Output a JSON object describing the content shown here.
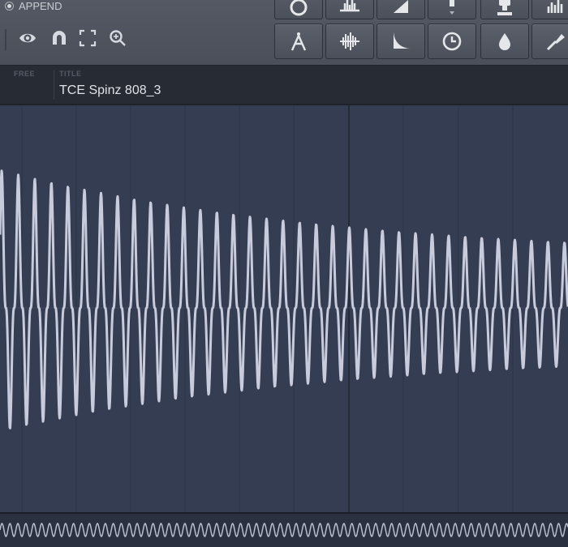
{
  "toolbar": {
    "append_label": "APPEND",
    "left_tools": [
      {
        "name": "eye-icon"
      },
      {
        "name": "magnet-icon"
      },
      {
        "name": "fit-view-icon"
      },
      {
        "name": "zoom-icon"
      }
    ],
    "buttons_row1": [
      {
        "name": "loop-icon"
      },
      {
        "name": "waveform-spike-icon"
      },
      {
        "name": "fade-icon"
      },
      {
        "name": "normalize-icon"
      },
      {
        "name": "stamp-icon"
      },
      {
        "name": "levels-icon"
      }
    ],
    "buttons_row2": [
      {
        "name": "compass-icon"
      },
      {
        "name": "spectrum-icon"
      },
      {
        "name": "decay-curve-icon"
      },
      {
        "name": "clock-icon"
      },
      {
        "name": "drop-icon"
      },
      {
        "name": "brush-icon"
      }
    ]
  },
  "info": {
    "free_label": "FREE",
    "title_label": "TITLE",
    "title_value": "TCE Spinz 808_3"
  },
  "colors": {
    "toolbar": "#4f545e",
    "info_bg": "#272b33",
    "wave_bg": "#353d52",
    "waveform": "#c8cbdc"
  }
}
